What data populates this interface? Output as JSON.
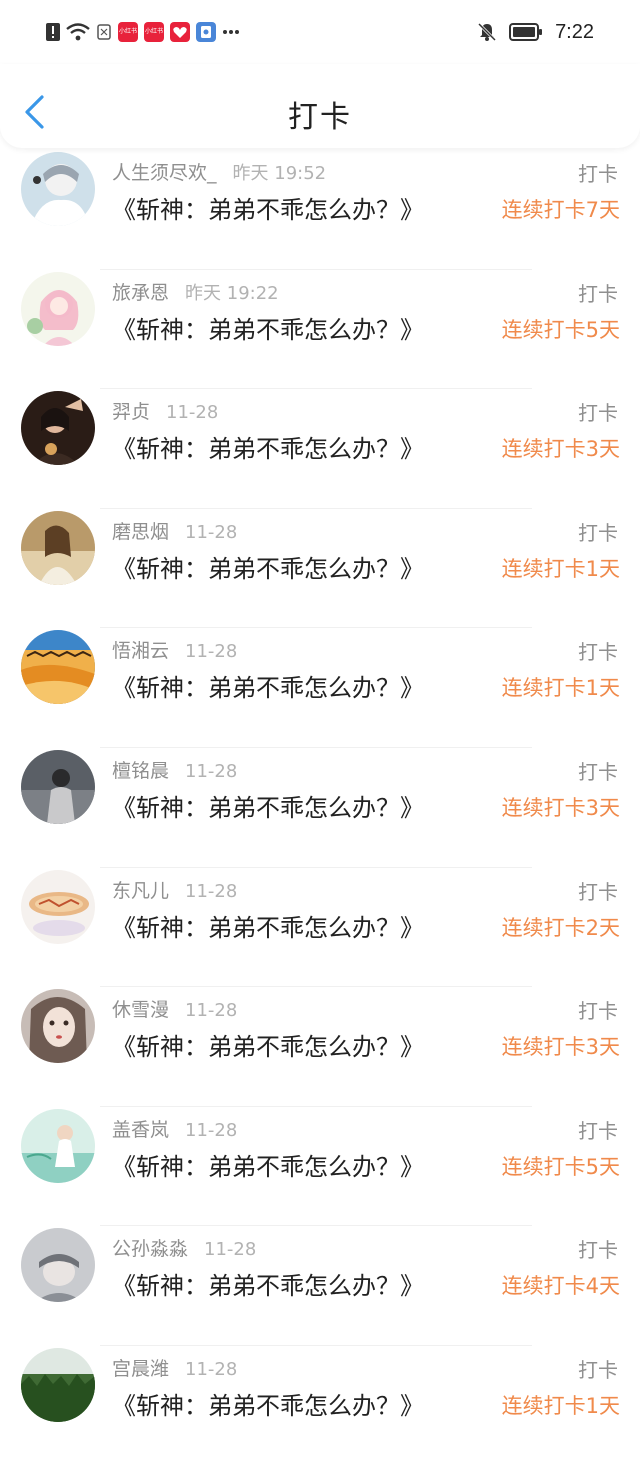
{
  "status_bar": {
    "time": "7:22",
    "icons": [
      "alert-icon",
      "wifi-icon",
      "vibrate-icon",
      "xiaohongshu-app-icon",
      "xiaohongshu-app-icon",
      "gift-app-icon",
      "clipboard-app-icon",
      "more-dots-icon",
      "bell-muted-icon",
      "battery-icon"
    ],
    "app_badge_label": "小红书"
  },
  "header": {
    "title": "打卡",
    "back_icon": "chevron-left-icon",
    "accent": "#3a97e8"
  },
  "colors": {
    "streak": "#f08a4b",
    "meta": "#8f8f8f",
    "text": "#222222"
  },
  "entries": [
    {
      "name": "人生须尽欢_",
      "time": "昨天 19:52",
      "book": "《斩神：弟弟不乖怎么办？》",
      "action": "打卡",
      "streak": "连续打卡7天"
    },
    {
      "name": "旅承恩",
      "time": "昨天 19:22",
      "book": "《斩神：弟弟不乖怎么办？》",
      "action": "打卡",
      "streak": "连续打卡5天"
    },
    {
      "name": "羿贞",
      "time": "11-28",
      "book": "《斩神：弟弟不乖怎么办？》",
      "action": "打卡",
      "streak": "连续打卡3天"
    },
    {
      "name": "磨思烟",
      "time": "11-28",
      "book": "《斩神：弟弟不乖怎么办？》",
      "action": "打卡",
      "streak": "连续打卡1天"
    },
    {
      "name": "悟湘云",
      "time": "11-28",
      "book": "《斩神：弟弟不乖怎么办？》",
      "action": "打卡",
      "streak": "连续打卡1天"
    },
    {
      "name": "檀铭晨",
      "time": "11-28",
      "book": "《斩神：弟弟不乖怎么办？》",
      "action": "打卡",
      "streak": "连续打卡3天"
    },
    {
      "name": "东凡儿",
      "time": "11-28",
      "book": "《斩神：弟弟不乖怎么办？》",
      "action": "打卡",
      "streak": "连续打卡2天"
    },
    {
      "name": "休雪漫",
      "time": "11-28",
      "book": "《斩神：弟弟不乖怎么办？》",
      "action": "打卡",
      "streak": "连续打卡3天"
    },
    {
      "name": "盖香岚",
      "time": "11-28",
      "book": "《斩神：弟弟不乖怎么办？》",
      "action": "打卡",
      "streak": "连续打卡5天"
    },
    {
      "name": "公孙淼淼",
      "time": "11-28",
      "book": "《斩神：弟弟不乖怎么办？》",
      "action": "打卡",
      "streak": "连续打卡4天"
    },
    {
      "name": "宫晨潍",
      "time": "11-28",
      "book": "《斩神：弟弟不乖怎么办？》",
      "action": "打卡",
      "streak": "连续打卡1天"
    }
  ]
}
